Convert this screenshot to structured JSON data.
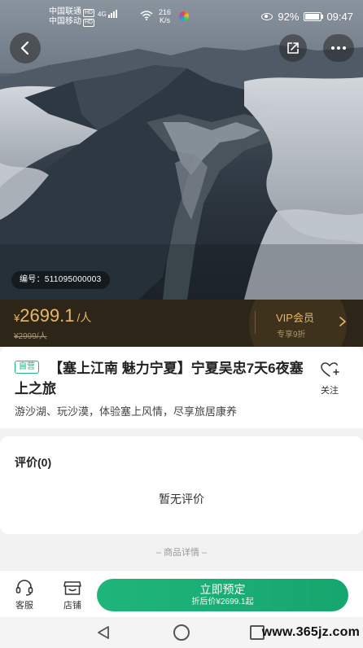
{
  "status_bar": {
    "carrier_1": "中国联通",
    "carrier_2": "中国移动",
    "hd_tag": "HD",
    "signal_label": "4G",
    "net_speed": "216",
    "net_speed_unit": "K/s",
    "battery": "92%",
    "time": "09:47"
  },
  "hero": {
    "product_code": "编号：511095000003"
  },
  "price": {
    "currency": "¥",
    "amount": "2699.1",
    "unit": "/人",
    "original": "¥2999/人",
    "vip_title": "VIP会员",
    "vip_sub": "专享9折"
  },
  "product": {
    "self_tag": "自营",
    "title": "【塞上江南 魅力宁夏】宁夏吴忠7天6夜塞上之旅",
    "subtitle": "游沙湖、玩沙漠，体验塞上风情，尽享旅居康养",
    "follow_label": "关注"
  },
  "reviews": {
    "title": "评价(0)",
    "empty_text": "暂无评价"
  },
  "detail_divider": "– 商品详情 –",
  "bottom_bar": {
    "service_label": "客服",
    "shop_label": "店铺",
    "book_label": "立即预定",
    "book_sub": "折后价¥2699.1起"
  },
  "watermark": "www.365jz.com",
  "colors": {
    "accent_green": "#1fb57a",
    "gold": "#e8b76a",
    "price_bar_bg": "#2d2618"
  }
}
